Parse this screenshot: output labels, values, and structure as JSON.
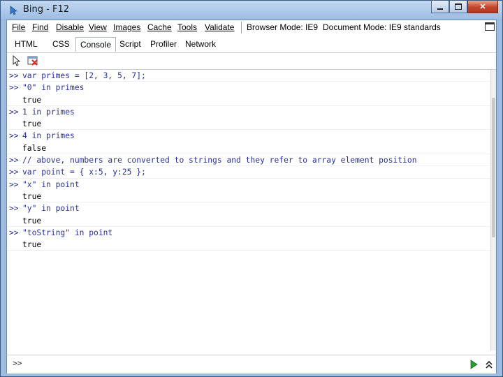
{
  "window": {
    "title": "Bing - F12"
  },
  "menu": {
    "items": [
      "File",
      "Find",
      "Disable",
      "View",
      "Images",
      "Cache",
      "Tools",
      "Validate"
    ],
    "browser_mode_label": "Browser Mode: IE9",
    "document_mode_label": "Document Mode: IE9 standards"
  },
  "tabs": [
    "HTML",
    "CSS",
    "Console",
    "Script",
    "Profiler",
    "Network"
  ],
  "active_tab": "Console",
  "console": {
    "prompt": ">>",
    "lines": [
      {
        "type": "input",
        "text": "var primes = [2, 3, 5, 7];"
      },
      {
        "type": "input",
        "text": "\"0\" in primes"
      },
      {
        "type": "output",
        "text": "true"
      },
      {
        "type": "input",
        "text": "1 in primes"
      },
      {
        "type": "output",
        "text": "true"
      },
      {
        "type": "input",
        "text": "4 in primes"
      },
      {
        "type": "output",
        "text": "false"
      },
      {
        "type": "input",
        "text": "// above, numbers are converted to strings and they refer to array element position"
      },
      {
        "type": "input",
        "text": "var point = { x:5, y:25 };"
      },
      {
        "type": "input",
        "text": "\"x\" in point"
      },
      {
        "type": "output",
        "text": "true"
      },
      {
        "type": "input",
        "text": "\"y\" in point"
      },
      {
        "type": "output",
        "text": "true"
      },
      {
        "type": "input",
        "text": "\"toString\" in point"
      },
      {
        "type": "output",
        "text": "true"
      }
    ],
    "input_prompt": ">>",
    "input_value": ""
  },
  "colors": {
    "input_text": "#27319a",
    "output_text": "#000000"
  }
}
